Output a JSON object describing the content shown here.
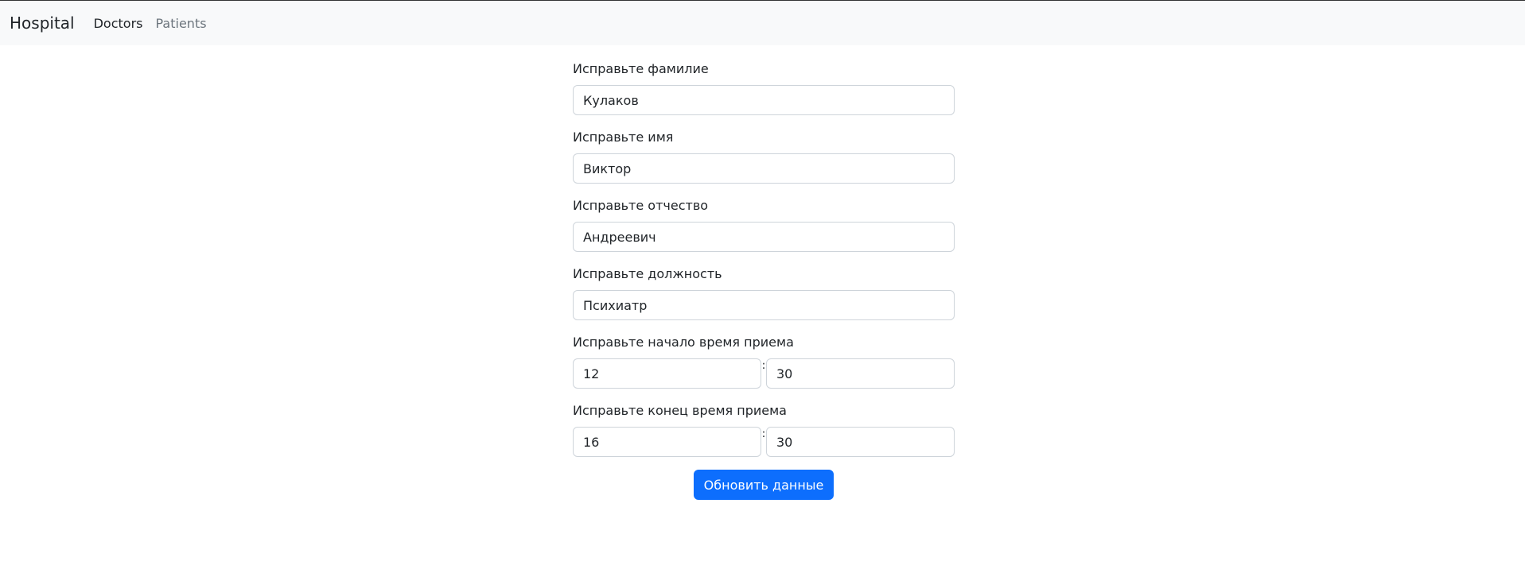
{
  "navbar": {
    "brand": "Hospital",
    "links": [
      {
        "label": "Doctors"
      },
      {
        "label": "Patients"
      }
    ]
  },
  "form": {
    "surname": {
      "label": "Исправьте фамилие",
      "value": "Кулаков"
    },
    "name": {
      "label": "Исправьте имя",
      "value": "Виктор"
    },
    "patronymic": {
      "label": "Исправьте отчество",
      "value": "Андреевич"
    },
    "position": {
      "label": "Исправьте должность",
      "value": "Психиатр"
    },
    "start_time": {
      "label": "Исправьте начало время приема",
      "hours": "12",
      "separator": ":",
      "minutes": "30"
    },
    "end_time": {
      "label": "Исправьте конец время приема",
      "hours": "16",
      "separator": ":",
      "minutes": "30"
    },
    "submit_label": "Обновить данные"
  },
  "colors": {
    "navbar_bg": "#f8f9fa",
    "primary": "#0d6efd",
    "border": "#ced4da"
  }
}
